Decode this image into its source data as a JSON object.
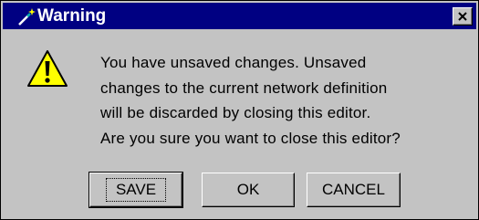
{
  "dialog": {
    "title": "Warning",
    "title_icon": "magic-wand-icon",
    "close_icon": "close-icon",
    "message_icon": "warning-icon",
    "message_lines": [
      "You have unsaved changes.  Unsaved",
      "changes to the current network definition",
      "will be discarded by closing this editor.",
      "Are you sure you want to close this editor?"
    ],
    "buttons": {
      "save": "SAVE",
      "ok": "OK",
      "cancel": "CANCEL"
    },
    "colors": {
      "titlebar": "#000082",
      "face": "#c3c3c3",
      "warning_yellow": "#ffff00"
    }
  }
}
